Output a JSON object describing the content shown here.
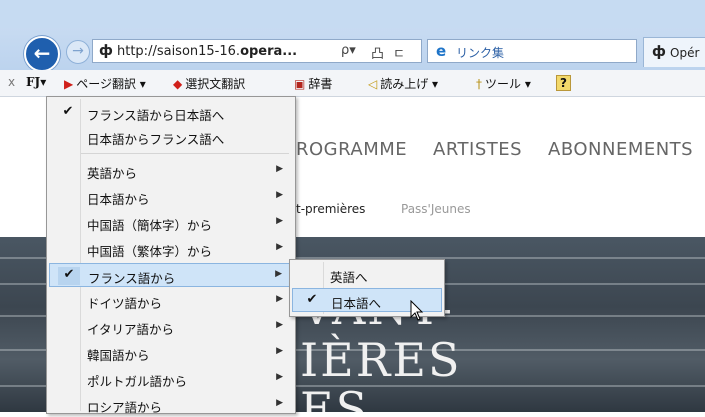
{
  "browser": {
    "url_text": "http://saison15-16.",
    "url_host": "opera...",
    "search_glyph": "ρ▾",
    "lock_glyph": "凸",
    "refresh_glyph": "ㄷ",
    "link_tab_label": "リンク集",
    "active_tab_label": "Opér",
    "site_icon": "ф"
  },
  "toolbar": {
    "close": "x",
    "fj_label": "FJ▾",
    "page_translate": "ページ翻訳 ▾",
    "selection_translate": "選択文翻訳",
    "dictionary": "辞書",
    "read_aloud": "読み上げ ▾",
    "tools": "ツール ▾",
    "help_icon": "?"
  },
  "page": {
    "nav": [
      "ROGRAMME",
      "ARTISTES",
      "ABONNEMENTS"
    ],
    "subnav": [
      "t-premières",
      "Pass'Jeunes"
    ],
    "hero_lines": [
      "VANT-",
      "IÈRES",
      "ES"
    ]
  },
  "menu": {
    "items": [
      {
        "label": "フランス語から日本語へ",
        "checked": true,
        "submenu": false
      },
      {
        "label": "日本語からフランス語へ",
        "checked": false,
        "submenu": false
      },
      {
        "label": "英語から",
        "checked": false,
        "submenu": true
      },
      {
        "label": "日本語から",
        "checked": false,
        "submenu": true
      },
      {
        "label": "中国語（簡体字）から",
        "checked": false,
        "submenu": true
      },
      {
        "label": "中国語（繁体字）から",
        "checked": false,
        "submenu": true
      },
      {
        "label": "フランス語から",
        "checked": true,
        "submenu": true
      },
      {
        "label": "ドイツ語から",
        "checked": false,
        "submenu": true
      },
      {
        "label": "イタリア語から",
        "checked": false,
        "submenu": true
      },
      {
        "label": "韓国語から",
        "checked": false,
        "submenu": true
      },
      {
        "label": "ポルトガル語から",
        "checked": false,
        "submenu": true
      },
      {
        "label": "ロシア語から",
        "checked": false,
        "submenu": true
      }
    ],
    "check_glyph": "✔",
    "arrow_glyph": "▶"
  },
  "submenu": {
    "items": [
      {
        "label": "英語へ",
        "checked": false
      },
      {
        "label": "日本語へ",
        "checked": true
      }
    ]
  }
}
